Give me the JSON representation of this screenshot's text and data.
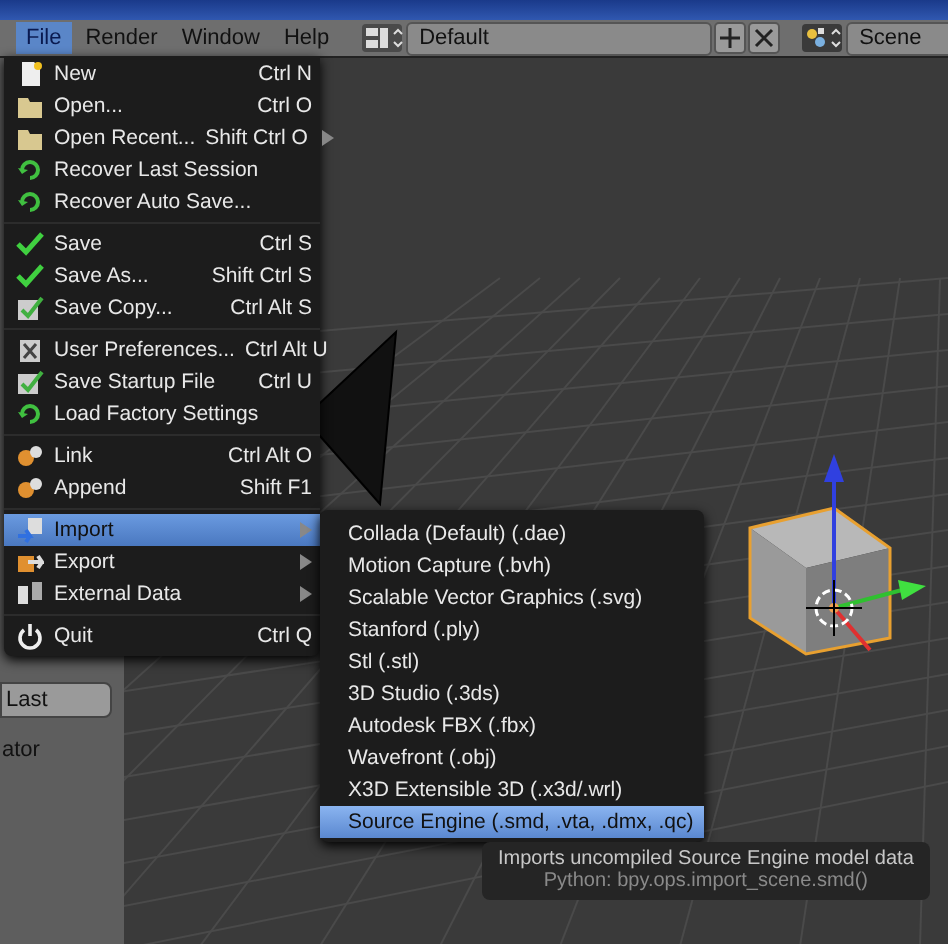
{
  "header": {
    "menus": [
      {
        "label": "File",
        "selected": true
      },
      {
        "label": "Render",
        "selected": false
      },
      {
        "label": "Window",
        "selected": false
      },
      {
        "label": "Help",
        "selected": false
      }
    ],
    "selectors": [
      {
        "kind": "layout",
        "value": "Default"
      },
      {
        "kind": "scene",
        "value": "Scene"
      }
    ]
  },
  "side_panel": {
    "button": "Last",
    "text": "ator"
  },
  "file_menu": {
    "groups": [
      [
        {
          "label": "New",
          "shortcut": "Ctrl N",
          "submenu": false,
          "selected": false
        },
        {
          "label": "Open...",
          "shortcut": "Ctrl O",
          "submenu": false,
          "selected": false
        },
        {
          "label": "Open Recent...",
          "shortcut": "Shift Ctrl O",
          "submenu": true,
          "selected": false
        },
        {
          "label": "Recover Last Session",
          "submenu": false,
          "selected": false
        },
        {
          "label": "Recover Auto Save...",
          "submenu": false,
          "selected": false
        }
      ],
      [
        {
          "label": "Save",
          "shortcut": "Ctrl S",
          "submenu": false,
          "selected": false
        },
        {
          "label": "Save As...",
          "shortcut": "Shift Ctrl S",
          "submenu": false,
          "selected": false
        },
        {
          "label": "Save Copy...",
          "shortcut": "Ctrl Alt S",
          "submenu": false,
          "selected": false
        }
      ],
      [
        {
          "label": "User Preferences...",
          "shortcut": "Ctrl Alt U",
          "submenu": false,
          "selected": false
        },
        {
          "label": "Save Startup File",
          "shortcut": "Ctrl U",
          "submenu": false,
          "selected": false
        },
        {
          "label": "Load Factory Settings",
          "submenu": false,
          "selected": false
        }
      ],
      [
        {
          "label": "Link",
          "shortcut": "Ctrl Alt O",
          "submenu": false,
          "selected": false
        },
        {
          "label": "Append",
          "shortcut": "Shift F1",
          "submenu": false,
          "selected": false
        }
      ],
      [
        {
          "label": "Import",
          "submenu": true,
          "selected": true
        },
        {
          "label": "Export",
          "submenu": true,
          "selected": false
        },
        {
          "label": "External Data",
          "submenu": true,
          "selected": false
        }
      ],
      [
        {
          "label": "Quit",
          "shortcut": "Ctrl Q",
          "submenu": false,
          "selected": false
        }
      ]
    ]
  },
  "import_menu": {
    "items": [
      {
        "label": "Collada (Default) (.dae)",
        "selected": false
      },
      {
        "label": "Motion Capture (.bvh)",
        "selected": false
      },
      {
        "label": "Scalable Vector Graphics (.svg)",
        "selected": false
      },
      {
        "label": "Stanford (.ply)",
        "selected": false
      },
      {
        "label": "Stl (.stl)",
        "selected": false
      },
      {
        "label": "3D Studio (.3ds)",
        "selected": false
      },
      {
        "label": "Autodesk FBX (.fbx)",
        "selected": false
      },
      {
        "label": "Wavefront (.obj)",
        "selected": false
      },
      {
        "label": "X3D Extensible 3D (.x3d/.wrl)",
        "selected": false
      },
      {
        "label": "Source Engine (.smd, .vta, .dmx, .qc)",
        "selected": true
      }
    ]
  },
  "tooltip": {
    "description": "Imports uncompiled Source Engine model data",
    "python": "Python: bpy.ops.import_scene.smd()"
  }
}
